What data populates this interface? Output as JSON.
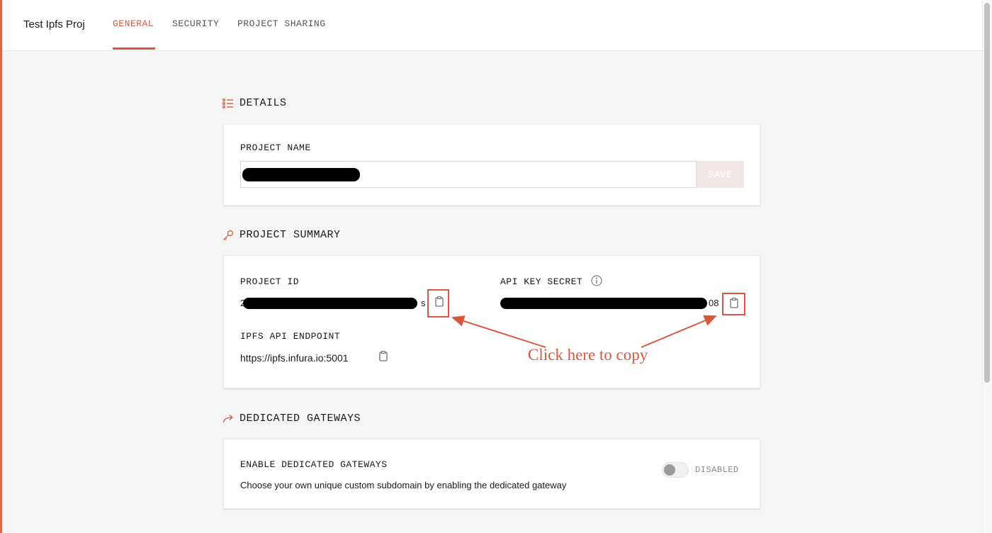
{
  "header": {
    "project_title": "Test Ipfs Proj",
    "tabs": [
      {
        "label": "GENERAL",
        "active": true
      },
      {
        "label": "SECURITY",
        "active": false
      },
      {
        "label": "PROJECT SHARING",
        "active": false
      }
    ]
  },
  "details": {
    "heading": "DETAILS",
    "heading_icon": "list-icon",
    "project_name_label": "PROJECT NAME",
    "project_name_value": "",
    "save_label": "SAVE"
  },
  "summary": {
    "heading": "PROJECT SUMMARY",
    "heading_icon": "key-icon",
    "project_id_label": "PROJECT ID",
    "project_id_prefix": "2",
    "project_id_suffix": "s",
    "api_key_secret_label": "API KEY SECRET",
    "api_key_secret_suffix": "08",
    "ipfs_endpoint_label": "IPFS API ENDPOINT",
    "ipfs_endpoint_value": "https://ipfs.infura.io:5001"
  },
  "annotation": {
    "text": "Click here to copy"
  },
  "gateways": {
    "heading": "DEDICATED GATEWAYS",
    "heading_icon": "arrow-share-icon",
    "enable_label": "ENABLE DEDICATED GATEWAYS",
    "description": "Choose your own unique custom subdomain by enabling the dedicated gateway",
    "toggle_state": "DISABLED"
  },
  "colors": {
    "accent": "#d9573f",
    "background": "#f5f5f5",
    "card": "#ffffff"
  }
}
